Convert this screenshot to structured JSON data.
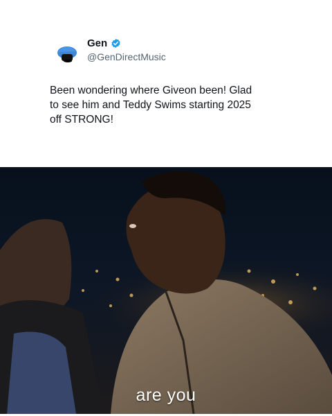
{
  "tweet": {
    "display_name": "Gen",
    "handle": "@GenDirectMusic",
    "text": "Been wondering where Giveon been! Glad\nto see him and Teddy Swims starting 2025\noff STRONG!",
    "verified": true,
    "avatar_icon": "blue-cap-avatar-icon",
    "verified_icon": "verified-badge-icon",
    "accent_color": "#1d9bf0"
  },
  "video": {
    "caption": "are you",
    "scene": "night-city-two-people-frame"
  }
}
